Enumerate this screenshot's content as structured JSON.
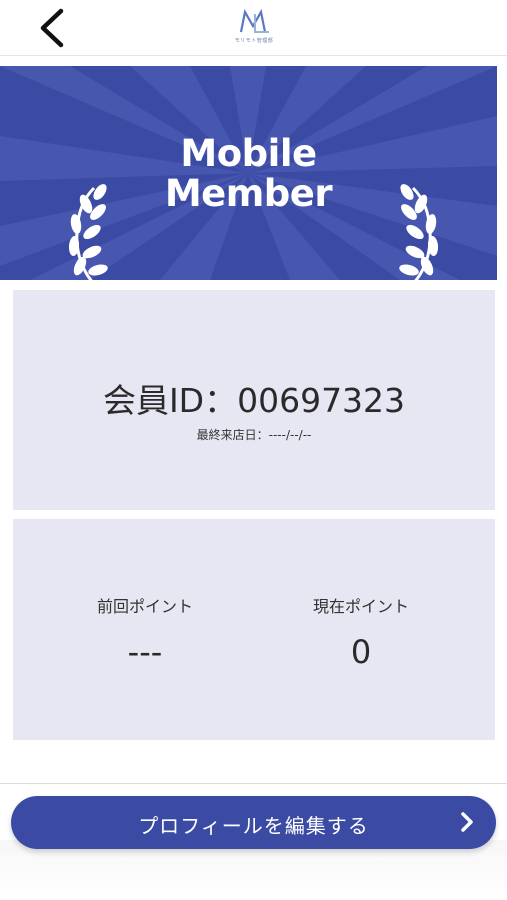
{
  "header": {
    "back_icon": "chevron-left-icon",
    "logo_text": "モリモト管理部"
  },
  "banner": {
    "title_line1": "Mobile",
    "title_line2": "Member",
    "background_color": "#3b4aa3",
    "decoration_icon": "laurel-icon"
  },
  "member": {
    "id_text": "会員ID：00697323",
    "last_visit": "最終来店日：----/--/--"
  },
  "points": {
    "previous_label": "前回ポイント",
    "previous_value": "---",
    "current_label": "現在ポイント",
    "current_value": "0"
  },
  "actions": {
    "edit_profile_label": "プロフィールを編集する",
    "edit_profile_icon": "chevron-right-icon"
  },
  "colors": {
    "accent": "#3b4aa3",
    "card_background": "#e7e7f3"
  }
}
